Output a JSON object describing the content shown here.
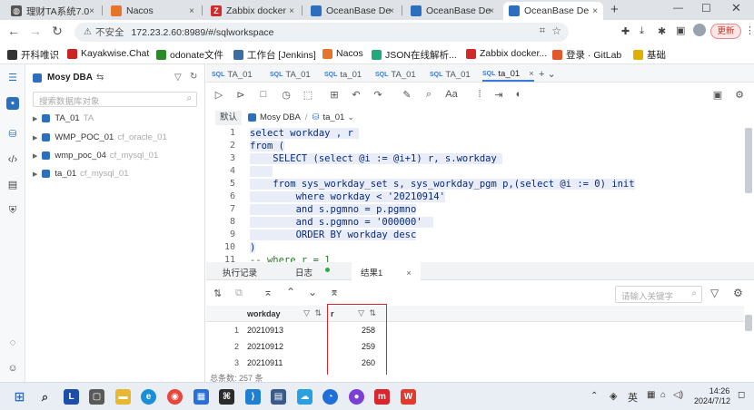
{
  "browser": {
    "tabs": [
      {
        "title": "理财TA系统7.0",
        "color": "#555"
      },
      {
        "title": "Nacos",
        "color": "#e8742c"
      },
      {
        "title": "Zabbix docker",
        "color": "#d12a2a"
      },
      {
        "title": "OceanBase De",
        "color": "#2c6fbe"
      },
      {
        "title": "OceanBase De",
        "color": "#2c6fbe"
      },
      {
        "title": "OceanBase De",
        "color": "#2c6fbe"
      }
    ],
    "close_glyph": "×",
    "new_tab": "+",
    "security_label": "不安全",
    "url": "172.23.2.60:8989/#/sqlworkspace",
    "update_button": "更新",
    "bookmarks": [
      {
        "label": "开科唯识",
        "color": "#333"
      },
      {
        "label": "Kayakwise.Chat",
        "color": "#c22"
      },
      {
        "label": "odonate文件",
        "color": "#2a8a2a"
      },
      {
        "label": "工作台 [Jenkins]",
        "color": "#3a6ea5"
      },
      {
        "label": "Nacos",
        "color": "#e8742c"
      },
      {
        "label": "JSON在线解析...",
        "color": "#23a87a"
      },
      {
        "label": "Zabbix docker...",
        "color": "#d12a2a"
      },
      {
        "label": "登录 · GitLab",
        "color": "#e2572c"
      },
      {
        "label": "基础",
        "color": "#e0b000"
      }
    ]
  },
  "sidebar": {
    "connection": "Mosy DBA",
    "switch_glyph": "⇆",
    "search_placeholder": "搜索数据库对象",
    "items": [
      {
        "name": "TA_01",
        "sub": "TA"
      },
      {
        "name": "WMP_POC_01",
        "sub": "cf_oracle_01"
      },
      {
        "name": "wmp_poc_04",
        "sub": "cf_mysql_01"
      },
      {
        "name": "ta_01",
        "sub": "cf_mysql_01"
      }
    ]
  },
  "editor": {
    "tabs": [
      "TA_01",
      "TA_01",
      "ta_01",
      "TA_01",
      "TA_01",
      "ta_01"
    ],
    "active_tab_index": 5,
    "sql_badge": "SQL",
    "add_tab": "+ ⌄",
    "breadcrumb": {
      "tag": "默认",
      "connection": "Mosy DBA",
      "separator": "/",
      "database": "ta_01"
    },
    "lines": [
      {
        "no": "1",
        "text": "select workday , r "
      },
      {
        "no": "2",
        "text": "from ("
      },
      {
        "no": "3",
        "text": "    SELECT (select @i := @i+1) r, s.workday "
      },
      {
        "no": "4",
        "text": "    "
      },
      {
        "no": "5",
        "text": "    from sys_workday_set s, sys_workday_pgm p,(select @i := 0) init"
      },
      {
        "no": "6",
        "text": "        where workday < '20210914'"
      },
      {
        "no": "7",
        "text": "        and s.pgmno = p.pgmno"
      },
      {
        "no": "8",
        "text": "        and s.pgmno = '000000'  "
      },
      {
        "no": "9",
        "text": "        ORDER BY workday desc"
      },
      {
        "no": "10",
        "text": ")"
      },
      {
        "no": "11",
        "text": "-- where r = 1    "
      }
    ]
  },
  "results": {
    "tabs": [
      "执行记录",
      "日志",
      "结果1"
    ],
    "active_tab": "结果1",
    "search_placeholder": "请输入关键字",
    "columns": [
      "workday",
      "r"
    ],
    "rows": [
      {
        "idx": "1",
        "workday": "20210913",
        "r": "258"
      },
      {
        "idx": "2",
        "workday": "20210912",
        "r": "259"
      },
      {
        "idx": "3",
        "workday": "20210911",
        "r": "260"
      }
    ],
    "total_label": "总条数: 257 条",
    "highlight_color": "#d9262c"
  },
  "taskbar": {
    "ime": "英",
    "time": "14:26",
    "date": "2024/7/12"
  }
}
